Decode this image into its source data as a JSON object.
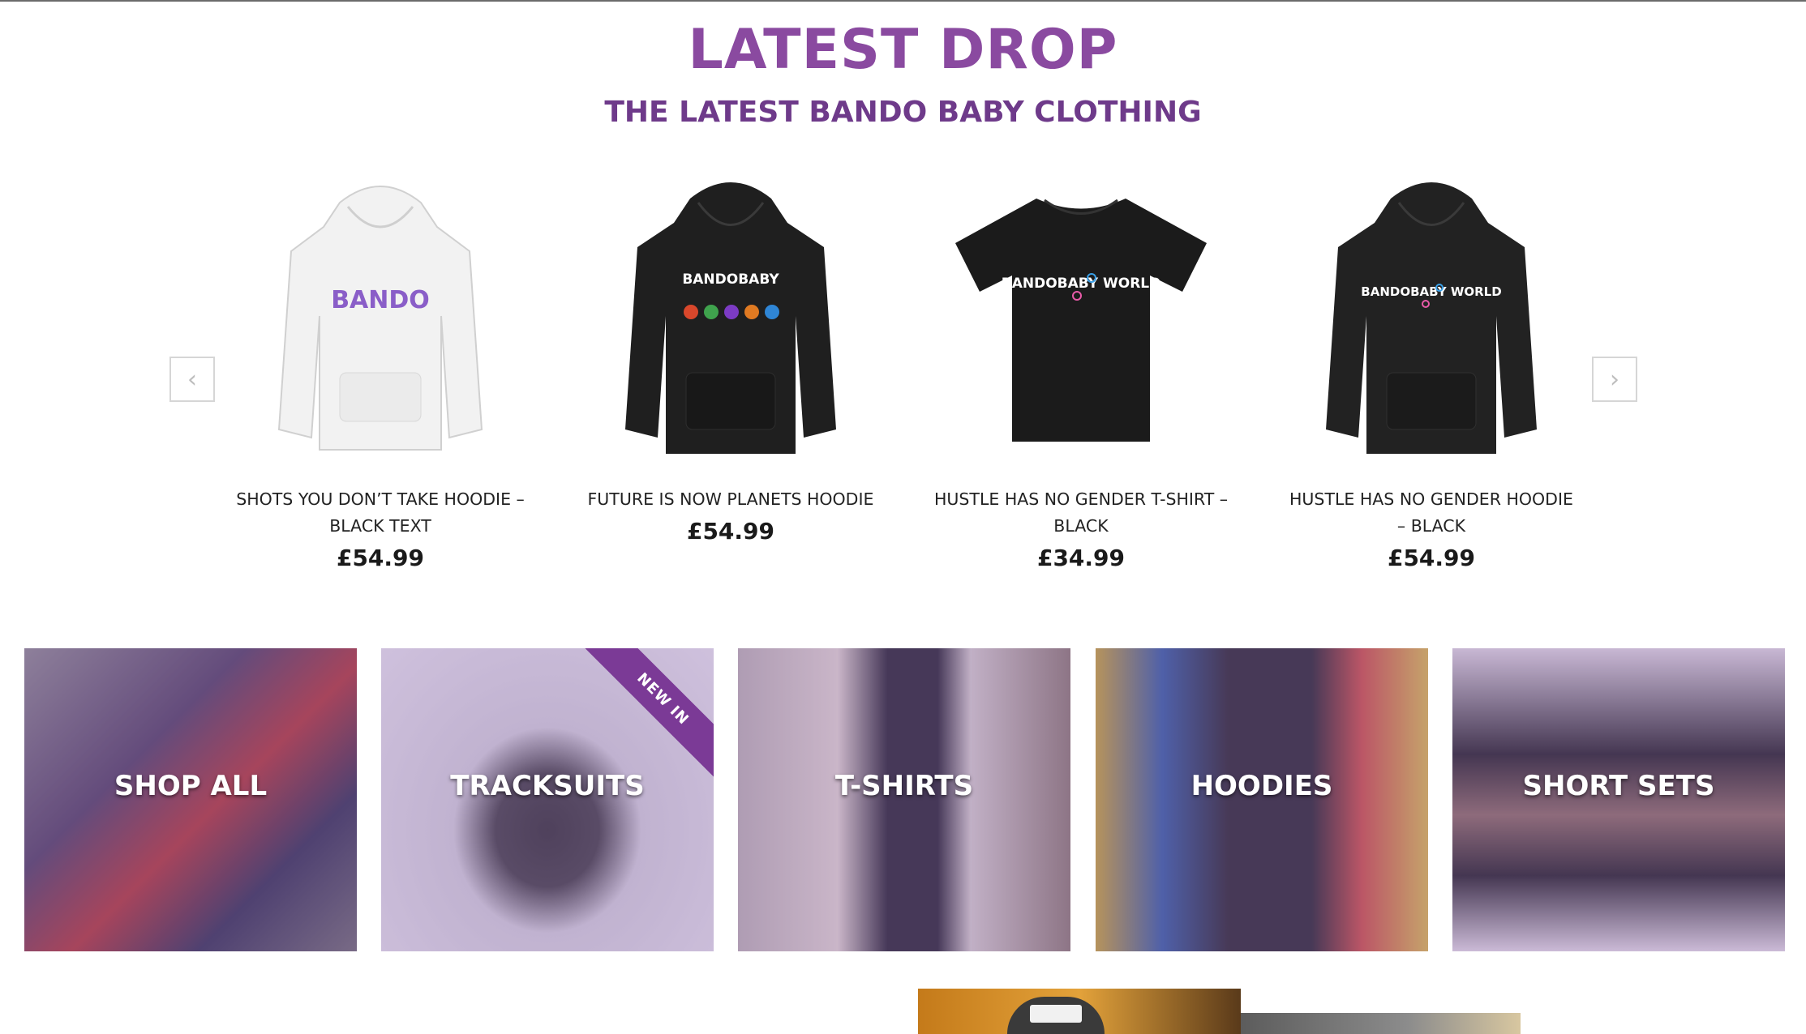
{
  "section": {
    "title": "LATEST DROP",
    "subtitle": "THE LATEST BANDO BABY CLOTHING"
  },
  "carousel": {
    "prev_icon": "chevron-left-icon",
    "next_icon": "chevron-right-icon",
    "prev_glyph": "‹",
    "next_glyph": "›"
  },
  "products": [
    {
      "name": "SHOTS YOU DON’T TAKE HOODIE – BLACK TEXT",
      "price": "£54.99",
      "garment": "hoodie",
      "color": "#f2f2f2",
      "print_text": "BANDO"
    },
    {
      "name": "FUTURE IS NOW PLANETS HOODIE",
      "price": "£54.99",
      "garment": "hoodie",
      "color": "#1f1f1f",
      "print_text": "BANDOBABY"
    },
    {
      "name": "HUSTLE HAS NO GENDER T-SHIRT – BLACK",
      "price": "£34.99",
      "garment": "tshirt",
      "color": "#1b1b1b",
      "print_text": "BANDOBABY WORLD"
    },
    {
      "name": "HUSTLE HAS NO GENDER HOODIE – BLACK",
      "price": "£54.99",
      "garment": "hoodie",
      "color": "#222222",
      "print_text": "BANDOBABY WORLD"
    }
  ],
  "categories": [
    {
      "label": "SHOP ALL"
    },
    {
      "label": "TRACKSUITS",
      "badge": "NEW IN"
    },
    {
      "label": "T-SHIRTS"
    },
    {
      "label": "HOODIES"
    },
    {
      "label": "SHORT SETS"
    }
  ],
  "colors": {
    "brand_purple": "#8a4aa0",
    "subtitle_purple": "#6e3a8a",
    "ribbon_purple": "#7b3a96"
  }
}
